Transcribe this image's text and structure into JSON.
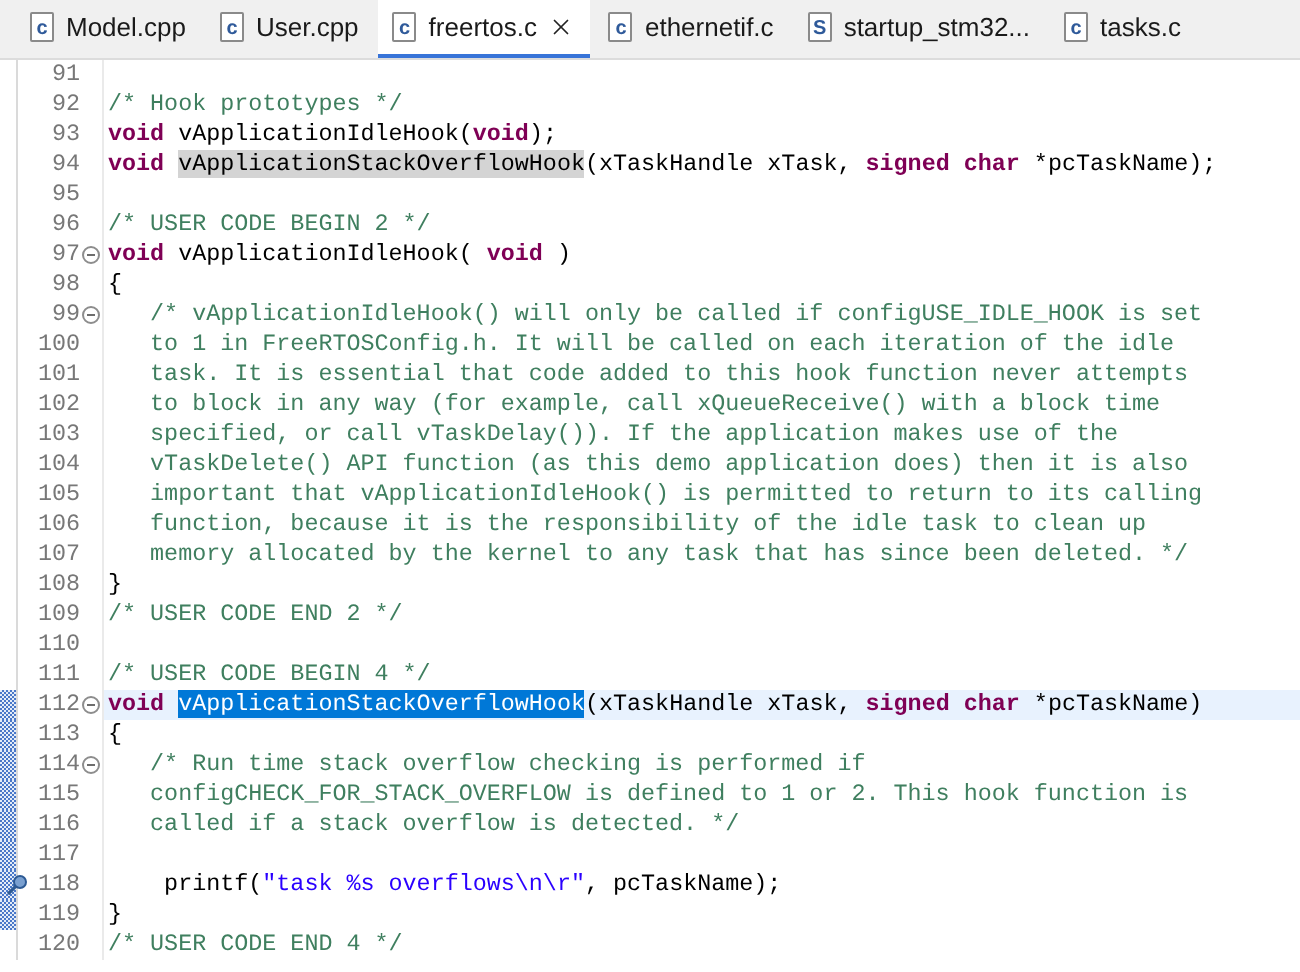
{
  "tabs": [
    {
      "label": "Model.cpp",
      "icon_letter": "c",
      "selected": false
    },
    {
      "label": "User.cpp",
      "icon_letter": "c",
      "selected": false
    },
    {
      "label": "freertos.c",
      "icon_letter": "c",
      "selected": true
    },
    {
      "label": "ethernetif.c",
      "icon_letter": "c",
      "selected": false
    },
    {
      "label": "startup_stm32...",
      "icon_letter": "S",
      "selected": false
    },
    {
      "label": "tasks.c",
      "icon_letter": "c",
      "selected": false
    }
  ],
  "lines": [
    {
      "number": "91",
      "fold": false,
      "changed": false,
      "current": false,
      "marker": false
    },
    {
      "number": "92",
      "fold": false,
      "changed": false,
      "current": false,
      "marker": false,
      "tokens": [
        {
          "kind": "comment",
          "text": "/* Hook prototypes */"
        }
      ]
    },
    {
      "number": "93",
      "fold": false,
      "changed": false,
      "current": false,
      "marker": false,
      "tokens": [
        {
          "kind": "keyword",
          "text": "void"
        },
        {
          "kind": "plain",
          "text": " vApplicationIdleHook("
        },
        {
          "kind": "keyword",
          "text": "void"
        },
        {
          "kind": "plain",
          "text": ");"
        }
      ]
    },
    {
      "number": "94",
      "fold": false,
      "changed": false,
      "current": false,
      "marker": false,
      "tokens": [
        {
          "kind": "keyword",
          "text": "void "
        },
        {
          "kind": "occurrence",
          "text": "vApplicationStackOverflowHook"
        },
        {
          "kind": "plain",
          "text": "(xTaskHandle xTask, "
        },
        {
          "kind": "keyword",
          "text": "signed char"
        },
        {
          "kind": "plain",
          "text": " *pcTaskName);"
        }
      ]
    },
    {
      "number": "95",
      "fold": false,
      "changed": false,
      "current": false,
      "marker": false
    },
    {
      "number": "96",
      "fold": false,
      "changed": false,
      "current": false,
      "marker": false,
      "tokens": [
        {
          "kind": "comment",
          "text": "/* USER CODE BEGIN 2 */"
        }
      ]
    },
    {
      "number": "97",
      "fold": true,
      "changed": false,
      "current": false,
      "marker": false,
      "tokens": [
        {
          "kind": "keyword",
          "text": "void"
        },
        {
          "kind": "plain",
          "text": " vApplicationIdleHook( "
        },
        {
          "kind": "keyword",
          "text": "void"
        },
        {
          "kind": "plain",
          "text": " )"
        }
      ]
    },
    {
      "number": "98",
      "fold": false,
      "changed": false,
      "current": false,
      "marker": false,
      "tokens": [
        {
          "kind": "plain",
          "text": "{"
        }
      ]
    },
    {
      "number": "99",
      "fold": true,
      "changed": false,
      "current": false,
      "marker": false,
      "tokens": [
        {
          "kind": "comment",
          "text": "   /* vApplicationIdleHook() will only be called if configUSE_IDLE_HOOK is set"
        }
      ]
    },
    {
      "number": "100",
      "fold": false,
      "changed": false,
      "current": false,
      "marker": false,
      "tokens": [
        {
          "kind": "comment",
          "text": "   to 1 in FreeRTOSConfig.h. It will be called on each iteration of the idle"
        }
      ]
    },
    {
      "number": "101",
      "fold": false,
      "changed": false,
      "current": false,
      "marker": false,
      "tokens": [
        {
          "kind": "comment",
          "text": "   task. It is essential that code added to this hook function never attempts"
        }
      ]
    },
    {
      "number": "102",
      "fold": false,
      "changed": false,
      "current": false,
      "marker": false,
      "tokens": [
        {
          "kind": "comment",
          "text": "   to block in any way (for example, call xQueueReceive() with a block time"
        }
      ]
    },
    {
      "number": "103",
      "fold": false,
      "changed": false,
      "current": false,
      "marker": false,
      "tokens": [
        {
          "kind": "comment",
          "text": "   specified, or call vTaskDelay()). If the application makes use of the"
        }
      ]
    },
    {
      "number": "104",
      "fold": false,
      "changed": false,
      "current": false,
      "marker": false,
      "tokens": [
        {
          "kind": "comment",
          "text": "   vTaskDelete() API function (as this demo application does) then it is also"
        }
      ]
    },
    {
      "number": "105",
      "fold": false,
      "changed": false,
      "current": false,
      "marker": false,
      "tokens": [
        {
          "kind": "comment",
          "text": "   important that vApplicationIdleHook() is permitted to return to its calling"
        }
      ]
    },
    {
      "number": "106",
      "fold": false,
      "changed": false,
      "current": false,
      "marker": false,
      "tokens": [
        {
          "kind": "comment",
          "text": "   function, because it is the responsibility of the idle task to clean up"
        }
      ]
    },
    {
      "number": "107",
      "fold": false,
      "changed": false,
      "current": false,
      "marker": false,
      "tokens": [
        {
          "kind": "comment",
          "text": "   memory allocated by the kernel to any task that has since been deleted. */"
        }
      ]
    },
    {
      "number": "108",
      "fold": false,
      "changed": false,
      "current": false,
      "marker": false,
      "tokens": [
        {
          "kind": "plain",
          "text": "}"
        }
      ]
    },
    {
      "number": "109",
      "fold": false,
      "changed": false,
      "current": false,
      "marker": false,
      "tokens": [
        {
          "kind": "comment",
          "text": "/* USER CODE END 2 */"
        }
      ]
    },
    {
      "number": "110",
      "fold": false,
      "changed": false,
      "current": false,
      "marker": false
    },
    {
      "number": "111",
      "fold": false,
      "changed": false,
      "current": false,
      "marker": false,
      "tokens": [
        {
          "kind": "comment",
          "text": "/* USER CODE BEGIN 4 */"
        }
      ]
    },
    {
      "number": "112",
      "fold": true,
      "changed": true,
      "current": true,
      "marker": false,
      "tokens": [
        {
          "kind": "keyword",
          "text": "void "
        },
        {
          "kind": "selection",
          "text": "vApplicationStackOverflowHook"
        },
        {
          "kind": "plain",
          "text": "(xTaskHandle xTask, "
        },
        {
          "kind": "keyword",
          "text": "signed char"
        },
        {
          "kind": "plain",
          "text": " *pcTaskName)"
        }
      ]
    },
    {
      "number": "113",
      "fold": false,
      "changed": true,
      "current": false,
      "marker": false,
      "tokens": [
        {
          "kind": "plain",
          "text": "{"
        }
      ]
    },
    {
      "number": "114",
      "fold": true,
      "changed": true,
      "current": false,
      "marker": false,
      "tokens": [
        {
          "kind": "comment",
          "text": "   /* Run time stack overflow checking is performed if"
        }
      ]
    },
    {
      "number": "115",
      "fold": false,
      "changed": true,
      "current": false,
      "marker": false,
      "tokens": [
        {
          "kind": "comment",
          "text": "   configCHECK_FOR_STACK_OVERFLOW is defined to 1 or 2. This hook function is"
        }
      ]
    },
    {
      "number": "116",
      "fold": false,
      "changed": true,
      "current": false,
      "marker": false,
      "tokens": [
        {
          "kind": "comment",
          "text": "   called if a stack overflow is detected. */"
        }
      ]
    },
    {
      "number": "117",
      "fold": false,
      "changed": true,
      "current": false,
      "marker": false
    },
    {
      "number": "118",
      "fold": false,
      "changed": true,
      "current": false,
      "marker": true,
      "tokens": [
        {
          "kind": "plain",
          "text": "    printf("
        },
        {
          "kind": "string",
          "text": "\"task %s overflows\\n\\r\""
        },
        {
          "kind": "plain",
          "text": ", pcTaskName);"
        }
      ]
    },
    {
      "number": "119",
      "fold": false,
      "changed": true,
      "current": false,
      "marker": false,
      "tokens": [
        {
          "kind": "plain",
          "text": "}"
        }
      ]
    },
    {
      "number": "120",
      "fold": false,
      "changed": false,
      "current": false,
      "marker": false,
      "tokens": [
        {
          "kind": "comment",
          "text": "/* USER CODE END 4 */"
        }
      ]
    }
  ]
}
